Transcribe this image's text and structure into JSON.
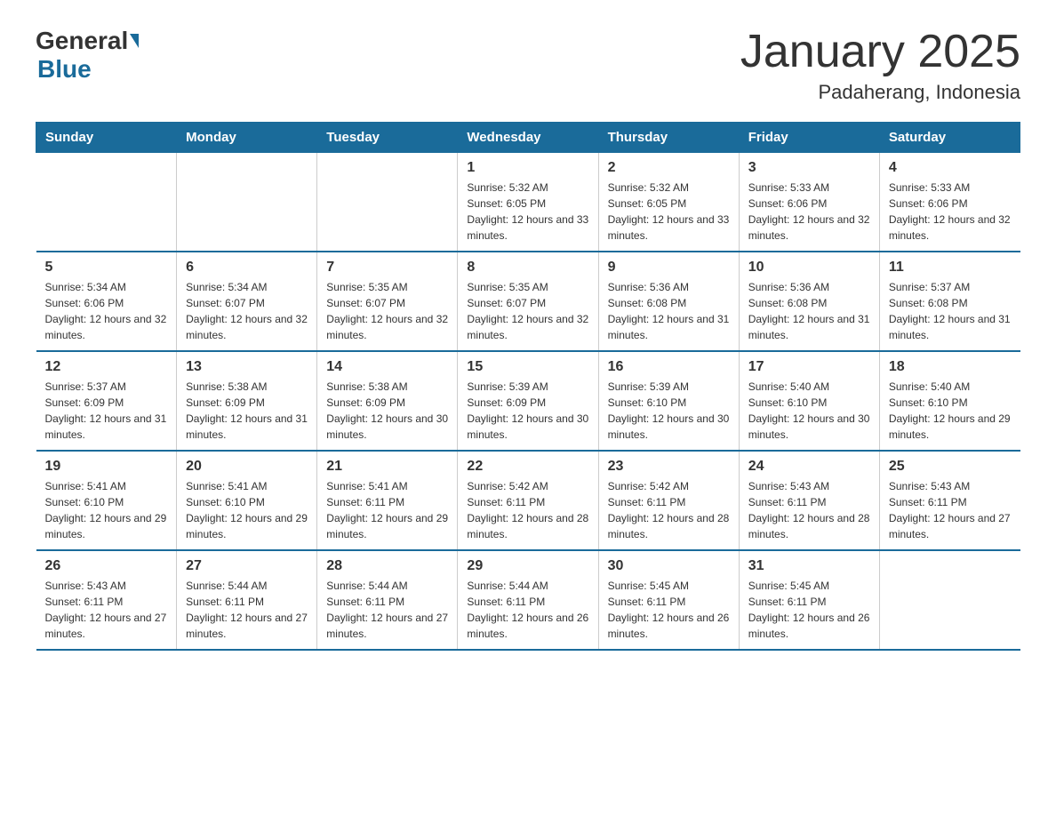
{
  "logo": {
    "general": "General",
    "blue": "Blue"
  },
  "title": "January 2025",
  "location": "Padaherang, Indonesia",
  "days_of_week": [
    "Sunday",
    "Monday",
    "Tuesday",
    "Wednesday",
    "Thursday",
    "Friday",
    "Saturday"
  ],
  "weeks": [
    [
      {
        "day": "",
        "info": ""
      },
      {
        "day": "",
        "info": ""
      },
      {
        "day": "",
        "info": ""
      },
      {
        "day": "1",
        "info": "Sunrise: 5:32 AM\nSunset: 6:05 PM\nDaylight: 12 hours and 33 minutes."
      },
      {
        "day": "2",
        "info": "Sunrise: 5:32 AM\nSunset: 6:05 PM\nDaylight: 12 hours and 33 minutes."
      },
      {
        "day": "3",
        "info": "Sunrise: 5:33 AM\nSunset: 6:06 PM\nDaylight: 12 hours and 32 minutes."
      },
      {
        "day": "4",
        "info": "Sunrise: 5:33 AM\nSunset: 6:06 PM\nDaylight: 12 hours and 32 minutes."
      }
    ],
    [
      {
        "day": "5",
        "info": "Sunrise: 5:34 AM\nSunset: 6:06 PM\nDaylight: 12 hours and 32 minutes."
      },
      {
        "day": "6",
        "info": "Sunrise: 5:34 AM\nSunset: 6:07 PM\nDaylight: 12 hours and 32 minutes."
      },
      {
        "day": "7",
        "info": "Sunrise: 5:35 AM\nSunset: 6:07 PM\nDaylight: 12 hours and 32 minutes."
      },
      {
        "day": "8",
        "info": "Sunrise: 5:35 AM\nSunset: 6:07 PM\nDaylight: 12 hours and 32 minutes."
      },
      {
        "day": "9",
        "info": "Sunrise: 5:36 AM\nSunset: 6:08 PM\nDaylight: 12 hours and 31 minutes."
      },
      {
        "day": "10",
        "info": "Sunrise: 5:36 AM\nSunset: 6:08 PM\nDaylight: 12 hours and 31 minutes."
      },
      {
        "day": "11",
        "info": "Sunrise: 5:37 AM\nSunset: 6:08 PM\nDaylight: 12 hours and 31 minutes."
      }
    ],
    [
      {
        "day": "12",
        "info": "Sunrise: 5:37 AM\nSunset: 6:09 PM\nDaylight: 12 hours and 31 minutes."
      },
      {
        "day": "13",
        "info": "Sunrise: 5:38 AM\nSunset: 6:09 PM\nDaylight: 12 hours and 31 minutes."
      },
      {
        "day": "14",
        "info": "Sunrise: 5:38 AM\nSunset: 6:09 PM\nDaylight: 12 hours and 30 minutes."
      },
      {
        "day": "15",
        "info": "Sunrise: 5:39 AM\nSunset: 6:09 PM\nDaylight: 12 hours and 30 minutes."
      },
      {
        "day": "16",
        "info": "Sunrise: 5:39 AM\nSunset: 6:10 PM\nDaylight: 12 hours and 30 minutes."
      },
      {
        "day": "17",
        "info": "Sunrise: 5:40 AM\nSunset: 6:10 PM\nDaylight: 12 hours and 30 minutes."
      },
      {
        "day": "18",
        "info": "Sunrise: 5:40 AM\nSunset: 6:10 PM\nDaylight: 12 hours and 29 minutes."
      }
    ],
    [
      {
        "day": "19",
        "info": "Sunrise: 5:41 AM\nSunset: 6:10 PM\nDaylight: 12 hours and 29 minutes."
      },
      {
        "day": "20",
        "info": "Sunrise: 5:41 AM\nSunset: 6:10 PM\nDaylight: 12 hours and 29 minutes."
      },
      {
        "day": "21",
        "info": "Sunrise: 5:41 AM\nSunset: 6:11 PM\nDaylight: 12 hours and 29 minutes."
      },
      {
        "day": "22",
        "info": "Sunrise: 5:42 AM\nSunset: 6:11 PM\nDaylight: 12 hours and 28 minutes."
      },
      {
        "day": "23",
        "info": "Sunrise: 5:42 AM\nSunset: 6:11 PM\nDaylight: 12 hours and 28 minutes."
      },
      {
        "day": "24",
        "info": "Sunrise: 5:43 AM\nSunset: 6:11 PM\nDaylight: 12 hours and 28 minutes."
      },
      {
        "day": "25",
        "info": "Sunrise: 5:43 AM\nSunset: 6:11 PM\nDaylight: 12 hours and 27 minutes."
      }
    ],
    [
      {
        "day": "26",
        "info": "Sunrise: 5:43 AM\nSunset: 6:11 PM\nDaylight: 12 hours and 27 minutes."
      },
      {
        "day": "27",
        "info": "Sunrise: 5:44 AM\nSunset: 6:11 PM\nDaylight: 12 hours and 27 minutes."
      },
      {
        "day": "28",
        "info": "Sunrise: 5:44 AM\nSunset: 6:11 PM\nDaylight: 12 hours and 27 minutes."
      },
      {
        "day": "29",
        "info": "Sunrise: 5:44 AM\nSunset: 6:11 PM\nDaylight: 12 hours and 26 minutes."
      },
      {
        "day": "30",
        "info": "Sunrise: 5:45 AM\nSunset: 6:11 PM\nDaylight: 12 hours and 26 minutes."
      },
      {
        "day": "31",
        "info": "Sunrise: 5:45 AM\nSunset: 6:11 PM\nDaylight: 12 hours and 26 minutes."
      },
      {
        "day": "",
        "info": ""
      }
    ]
  ]
}
